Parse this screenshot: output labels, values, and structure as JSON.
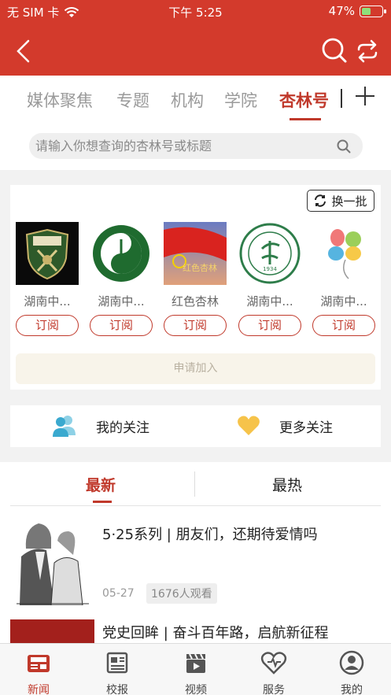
{
  "status_bar": {
    "carrier": "无 SIM 卡",
    "time": "下午 5:25",
    "battery": "47%",
    "battery_level": 0.47
  },
  "header": {
    "back_icon": "chevron-left-icon",
    "search_icon": "search-icon",
    "switch_icon": "switch-icon"
  },
  "tabs": [
    {
      "label": "媒体聚焦"
    },
    {
      "label": "专题"
    },
    {
      "label": "机构"
    },
    {
      "label": "学院"
    },
    {
      "label": "杏林号"
    }
  ],
  "search": {
    "placeholder": "请输入你想查询的杏林号或标题"
  },
  "recommend": {
    "refresh_label": "换一批",
    "accounts": [
      {
        "name": "湖南中...",
        "subscribe": "订阅"
      },
      {
        "name": "湖南中...",
        "subscribe": "订阅"
      },
      {
        "name": "红色杏林",
        "subscribe": "订阅",
        "logo_text": "红色杏林"
      },
      {
        "name": "湖南中...",
        "subscribe": "订阅",
        "logo_text": "1934"
      },
      {
        "name": "湖南中...",
        "subscribe": "订阅"
      }
    ],
    "apply_label": "申请加入"
  },
  "follow": {
    "my_follow": "我的关注",
    "more_follow": "更多关注"
  },
  "feed": {
    "tabs": [
      {
        "label": "最新"
      },
      {
        "label": "最热"
      }
    ],
    "items": [
      {
        "title": "5·25系列 | 朋友们，还期待爱情吗",
        "date": "05-27",
        "views": "1676人观看"
      },
      {
        "title": "党史回眸 | 奋斗百年路，启航新征程"
      }
    ]
  },
  "bottom_nav": [
    {
      "label": "新闻",
      "icon": "news-icon"
    },
    {
      "label": "校报",
      "icon": "newspaper-icon"
    },
    {
      "label": "视频",
      "icon": "video-icon"
    },
    {
      "label": "服务",
      "icon": "heart-icon"
    },
    {
      "label": "我的",
      "icon": "user-icon"
    }
  ],
  "colors": {
    "brand_red": "#d33a2c",
    "accent_red": "#c0392b",
    "apply_bg": "#f8f4ea"
  }
}
